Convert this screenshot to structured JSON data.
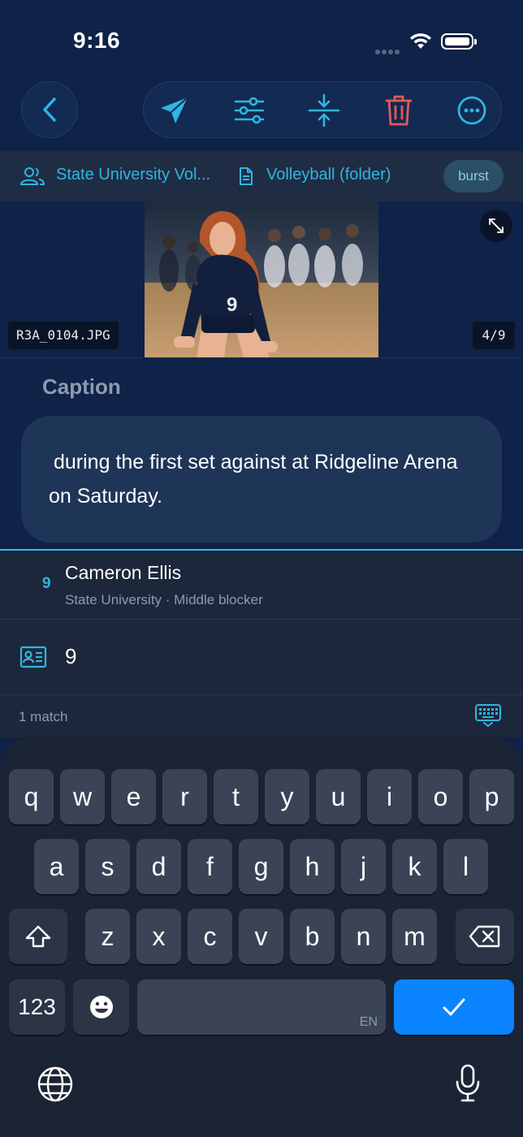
{
  "status_bar": {
    "time": "9:16"
  },
  "toolbar": {
    "tools": [
      "send-icon",
      "sliders-icon",
      "compress-icon",
      "trash-icon",
      "more-icon"
    ]
  },
  "info_bar": {
    "team": "State University Vol...",
    "folder": "Volleyball (folder)",
    "badge": "burst"
  },
  "photo": {
    "filename": "R3A_0104.JPG",
    "counter": "4/9",
    "jersey_number": "9"
  },
  "caption": {
    "label": "Caption",
    "text": "during the first set against at Ridgeline Arena on Saturday."
  },
  "suggestion": {
    "number": "9",
    "name": "Cameron Ellis",
    "subtitle": "State University · Middle blocker"
  },
  "input": {
    "value": "9"
  },
  "matches": {
    "text": "1 match"
  },
  "keyboard": {
    "row1": [
      "q",
      "w",
      "e",
      "r",
      "t",
      "y",
      "u",
      "i",
      "o",
      "p"
    ],
    "row2": [
      "a",
      "s",
      "d",
      "f",
      "g",
      "h",
      "j",
      "k",
      "l"
    ],
    "row3": [
      "z",
      "x",
      "c",
      "v",
      "b",
      "n",
      "m"
    ],
    "numbers_label": "123",
    "space_lang": "EN"
  },
  "colors": {
    "accent": "#2fb6e0",
    "delete": "#e05a5a",
    "confirm": "#0a84ff",
    "background": "#0f2248"
  }
}
